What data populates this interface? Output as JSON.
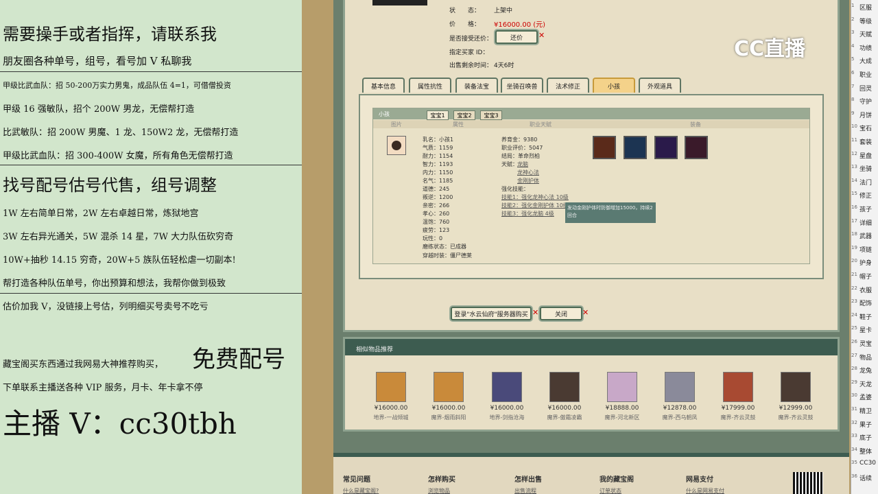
{
  "overlay": {
    "lines": [
      "需要操手或者指挥，请联系我",
      "朋友圈各种单号，组号，看号加 V 私聊我",
      "甲级比武血队：招 50-200万实力男鬼，成品队伍 4=1，可借僧投资",
      "甲级 16 强敏队，招个 200W 男龙，无偿帮打造",
      "比武敏队：招 200W 男魔、1 龙、150W2 龙，无偿帮打造",
      "甲级比武血队：招 300-400W 女魔，所有角色无偿帮打造",
      "找号配号估号代售，组号调整",
      "1W 左右简单日常，2W 左右卓越日常，炼狱地宫",
      "3W 左右异光通关，5W 混杀 14 星，7W 大力队伍砍穷奇",
      "10W+抽秒 14.15 穷奇，20W+5 族队伍轻松虐一切副本!",
      "帮打造各种队伍单号，你出预算和想法，我帮你做到极致",
      "估价加我 V，没链接上号估，列明细买号卖号不吃亏",
      "藏宝阁买东西通过我网易大神推荐购买，",
      "免费配号",
      "下单联系主播送各种 VIP 服务，月卡、年卡拿不停",
      "主播 V：cc30tbh"
    ]
  },
  "logo": "CC直播",
  "item": {
    "status_label": "状　　态：",
    "status": "上架中",
    "price_label": "价　　格：",
    "price": "¥16000.00 (元)",
    "bargain_label": "是否接受还价：",
    "bargain_btn": "还价",
    "buyer_label": "指定买家 ID：",
    "time_label": "出售剩余时间：",
    "time": "4天6时"
  },
  "tabs": [
    "基本信息",
    "属性抗性",
    "装备法宝",
    "坐骑召唤兽",
    "法术修正",
    "小孩",
    "外观道具"
  ],
  "child": {
    "header": "小孩",
    "subtabs": [
      "宝宝1",
      "宝宝2",
      "宝宝3"
    ],
    "cols": [
      "图片",
      "属性",
      "职业天赋",
      "装备"
    ],
    "attrs": [
      "乳名：小孩1",
      "气质：1159",
      "耐力：1154",
      "智力：1193",
      "内力：1150",
      "名气：1185",
      "道德：245",
      "叛逆：1200",
      "亲密：266",
      "孝心：260",
      "温饱：760",
      "疲劳：123",
      "玩性：0",
      "磨练状态：已成器",
      "穿越时装：僵尸德莱"
    ],
    "career": [
      "养育金：9380",
      "职业评价：5047",
      "结局：革命烈柏",
      "天赋："
    ],
    "talents": [
      "龙脑",
      "龙神心法",
      "金刚护体"
    ],
    "skill_label": "强化技能：",
    "skills": [
      "技能1：强化龙神心法 10级",
      "技能2：强化金刚护体 10级",
      "技能3：强化龙脑 4级"
    ],
    "tooltip": "发动金刚护体时防御增加15000，持续2回合"
  },
  "actions": {
    "buy": "登录\"水云仙府\"服务器购买",
    "close": "关闭"
  },
  "similar": {
    "title": "相似物品推荐",
    "items": [
      {
        "price": "¥16000.00",
        "server": "地界-一战倾城"
      },
      {
        "price": "¥16000.00",
        "server": "魔界-烟雨斜阳"
      },
      {
        "price": "¥16000.00",
        "server": "地界-剑指沧海"
      },
      {
        "price": "¥16000.00",
        "server": "魔界-傲霜凌霸"
      },
      {
        "price": "¥18888.00",
        "server": "魔界-河北新区"
      },
      {
        "price": "¥12878.00",
        "server": "魔界-西乌朝凤"
      },
      {
        "price": "¥17999.00",
        "server": "魔界-齐云灵鼓"
      },
      {
        "price": "¥12999.00",
        "server": "魔界-齐云灵鼓"
      }
    ]
  },
  "footer": {
    "heads": [
      "常见问题",
      "怎样购买",
      "怎样出售",
      "我的藏宝阁",
      "网易支付"
    ],
    "links": [
      "什么是藏宝阁?",
      "浏览物品",
      "出售流程",
      "订单状态",
      "什么是网易支付"
    ]
  },
  "sidebar": {
    "items": [
      "区服",
      "等级",
      "天赋",
      "功绩",
      "大成",
      "职业",
      "回灵",
      "守护",
      "月饼",
      "宝石",
      "套装",
      "星盘",
      "坐骑",
      "法门",
      "修正",
      "孩子",
      "详细",
      "武器",
      "项链",
      "护身",
      "帽子",
      "衣服",
      "配饰",
      "鞋子",
      "星卡",
      "灵宝",
      "物品",
      "龙兔",
      "天龙",
      "孟婆",
      "精卫",
      "果子",
      "底子",
      "整体",
      "CC30",
      "话续"
    ],
    "nums": [
      "1",
      "2",
      "3",
      "4",
      "5",
      "6",
      "7",
      "8",
      "9",
      "10",
      "11",
      "12",
      "13",
      "14",
      "15",
      "16",
      "17",
      "18",
      "19",
      "20",
      "21",
      "22",
      "23",
      "24",
      "25",
      "26",
      "27",
      "28",
      "29",
      "30",
      "31",
      "32",
      "33",
      "34",
      "35",
      "36"
    ]
  }
}
